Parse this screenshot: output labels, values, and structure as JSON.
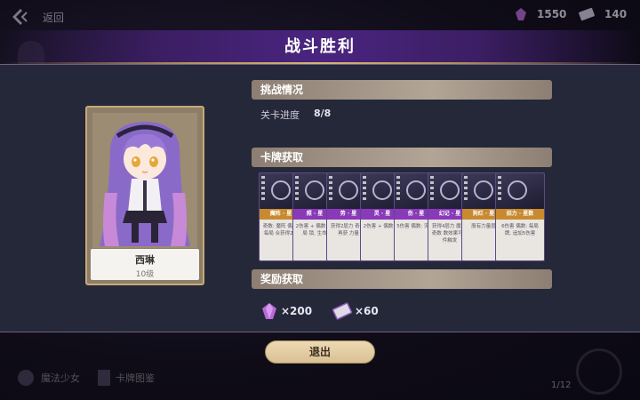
{
  "topbar": {
    "back_label": "返回",
    "crystals": "1550",
    "tickets": "140"
  },
  "title": "战斗胜利",
  "character": {
    "name": "西琳",
    "level": "10级"
  },
  "challenge": {
    "header": "挑战情况",
    "progress_label": "关卡进度",
    "progress_value": "8/8"
  },
  "cards_section": {
    "header": "卡牌获取",
    "cards": [
      {
        "tag": "魔阵 · 星",
        "tag_color": "#c98a2f",
        "desc": "奇数: 魔阵 偶数: 每局 合获得2层"
      },
      {
        "tag": "照 · 星",
        "tag_color": "#8a39b8",
        "desc": "2伤害 + 偶数: 每局 锁, 生命"
      },
      {
        "tag": "势 · 星",
        "tag_color": "#8a39b8",
        "desc": "获得2层力 奇数: 再获 力量"
      },
      {
        "tag": "灵 · 星",
        "tag_color": "#8a39b8",
        "desc": "2伤害 + 偶数: 流"
      },
      {
        "tag": "伤 · 星",
        "tag_color": "#8a39b8",
        "desc": "5伤害 偶数: 流 伤"
      },
      {
        "tag": "幻记 · 星",
        "tag_color": "#8a39b8",
        "desc": "获得4层力 魔阵: 奇数 数效果可以 件触发"
      },
      {
        "tag": "狗烂 · 星",
        "tag_color": "#c98a2f",
        "desc": "股有力量层"
      },
      {
        "tag": "招力 · 星数",
        "tag_color": "#c98a2f",
        "desc": "6伤害 偶数: 每局 牌, 追加5伤害"
      }
    ]
  },
  "rewards_section": {
    "header": "奖励获取",
    "crystal_amount": "×200",
    "ticket_amount": "×60"
  },
  "exit_label": "退出",
  "bottom": {
    "left_label": "魔法少女",
    "mid_label": "卡牌图鉴",
    "page": "1/12"
  },
  "colors": {
    "accent_gold": "#c9a877",
    "title_purple": "#4a2580",
    "button_beige": "#e6d2a8"
  }
}
